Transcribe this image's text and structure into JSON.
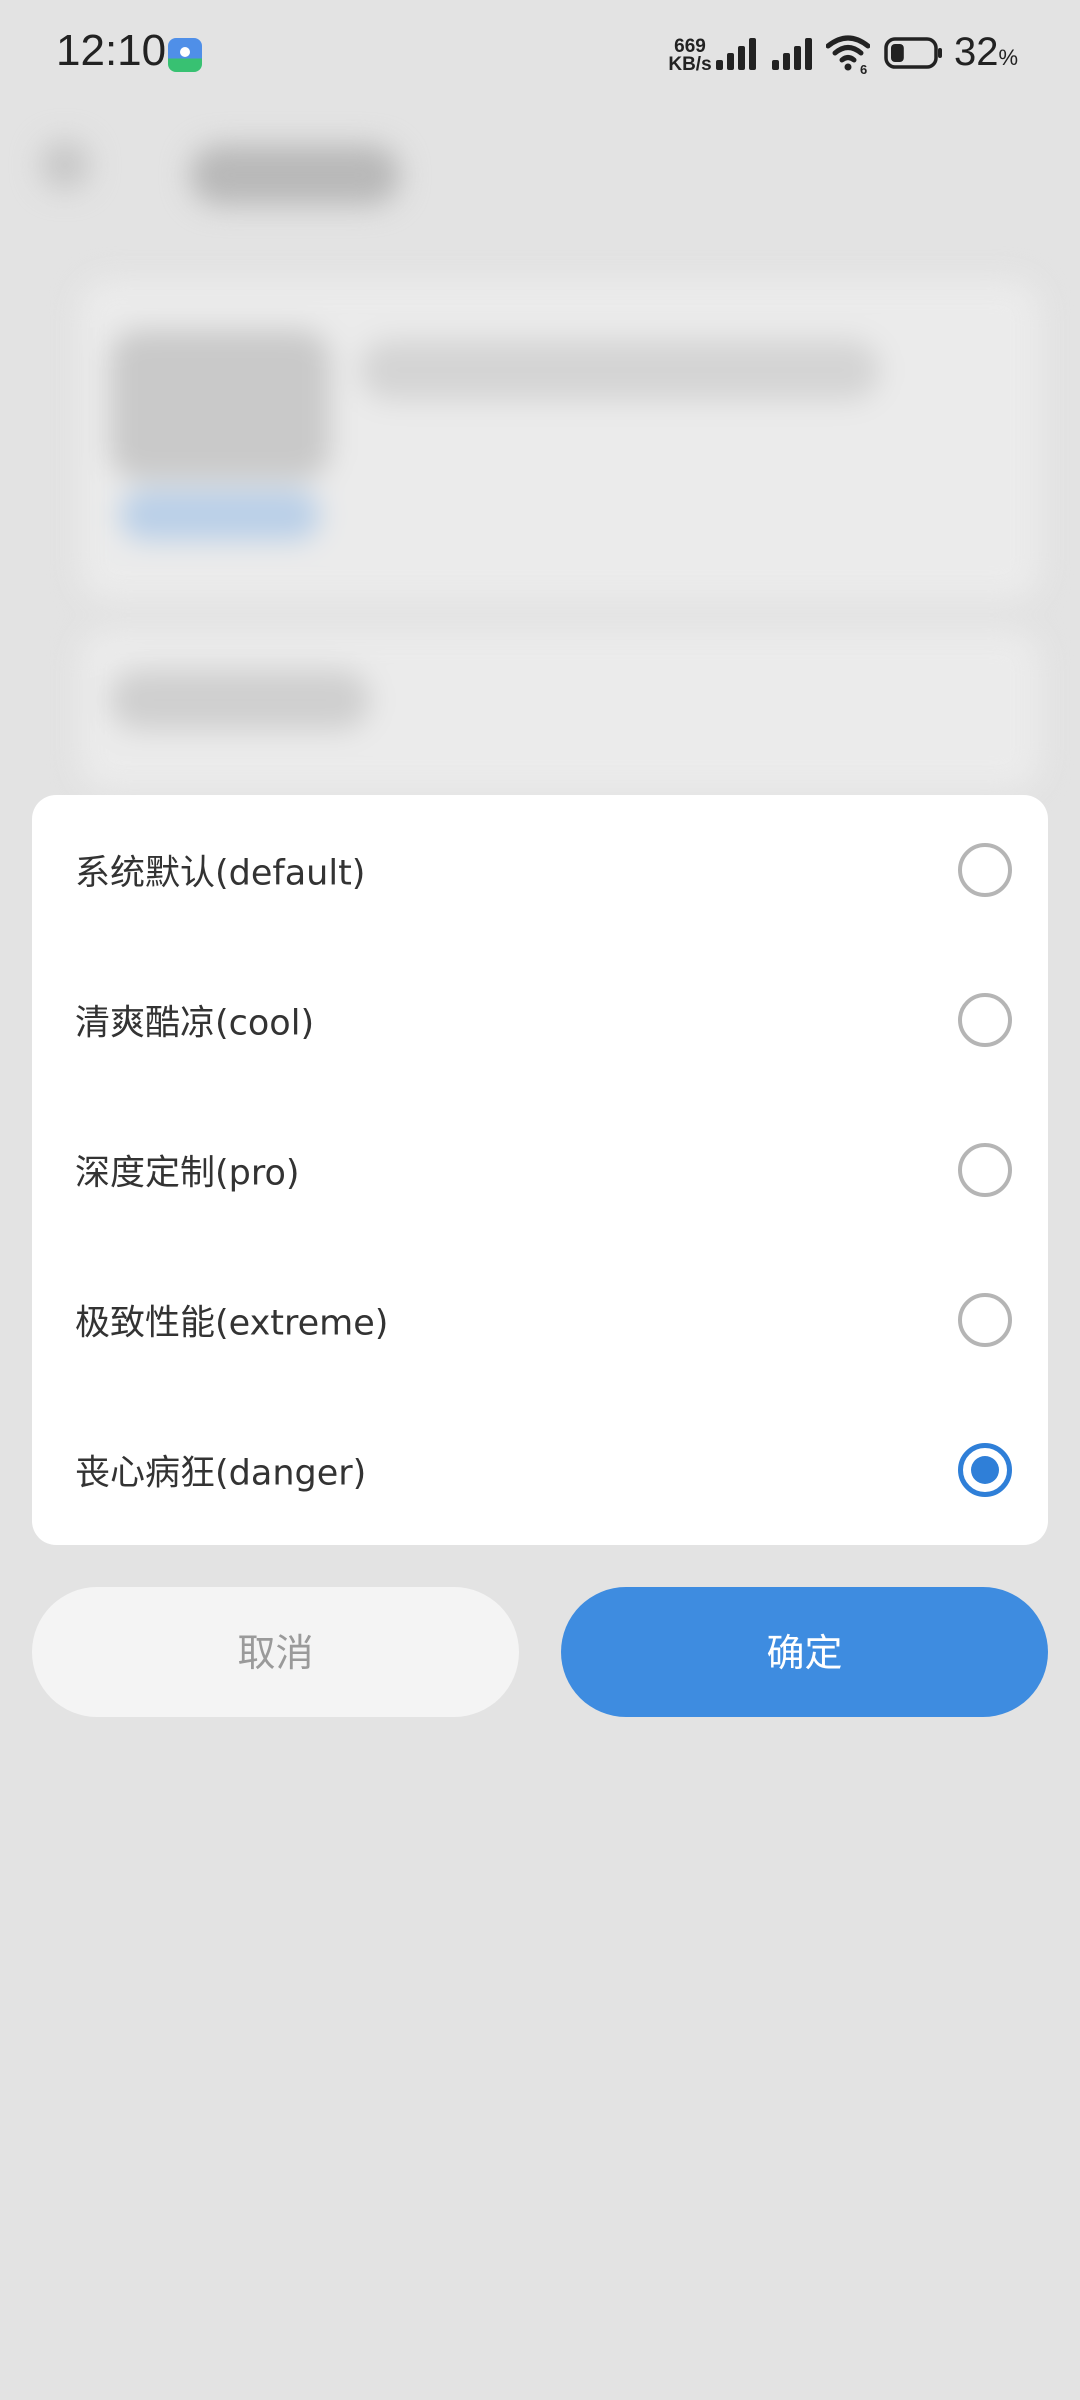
{
  "status_bar": {
    "time": "12:10",
    "net_speed_value": "669",
    "net_speed_unit": "KB/s",
    "wifi_badge": "6",
    "battery_level": "32",
    "battery_unit": "%",
    "battery_fraction": 0.32
  },
  "dialog": {
    "options": [
      {
        "label": "系统默认(default)",
        "selected": false
      },
      {
        "label": "清爽酷凉(cool)",
        "selected": false
      },
      {
        "label": "深度定制(pro)",
        "selected": false
      },
      {
        "label": "极致性能(extreme)",
        "selected": false
      },
      {
        "label": "丧心病狂(danger)",
        "selected": true
      }
    ],
    "accent_color": "#2f7fd8"
  },
  "buttons": {
    "cancel_label": "取消",
    "confirm_label": "确定",
    "confirm_color": "#3e8ce0"
  }
}
